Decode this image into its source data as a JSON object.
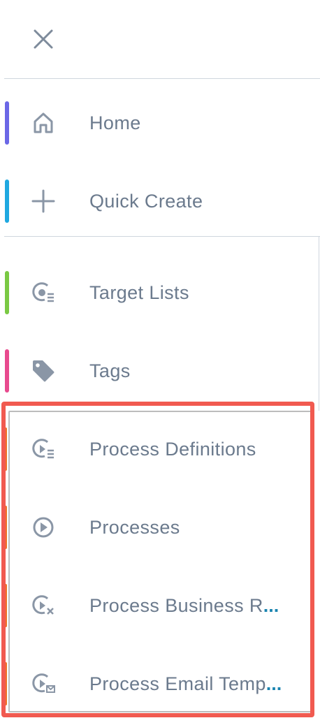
{
  "close": {
    "icon": "close-icon"
  },
  "menu": {
    "items": [
      {
        "label": "Home",
        "icon": "home-icon",
        "accent": "#6b67e6"
      },
      {
        "label": "Quick Create",
        "icon": "plus-icon",
        "accent": "#1fa8e0"
      },
      {
        "label": "Target Lists",
        "icon": "target-list-icon",
        "accent": "#7ac943"
      },
      {
        "label": "Tags",
        "icon": "tag-icon",
        "accent": "#e84a8e"
      },
      {
        "label": "Process Definitions",
        "icon": "process-definition-icon",
        "accent": "#f07428"
      },
      {
        "label": "Processes",
        "icon": "play-circle-icon",
        "accent": "#f07428"
      },
      {
        "label": "Process Business R",
        "truncated": "...",
        "icon": "process-business-rule-icon",
        "accent": "#f07428"
      },
      {
        "label": "Process Email Temp",
        "truncated": "...",
        "icon": "process-email-template-icon",
        "accent": "#f07428"
      }
    ]
  },
  "highlight_color": "#f15a50"
}
